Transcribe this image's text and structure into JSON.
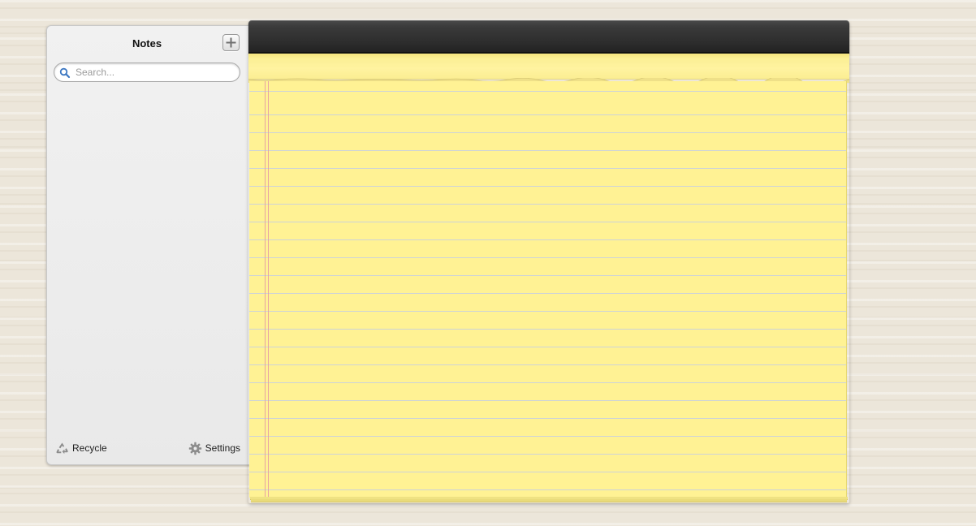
{
  "sidebar": {
    "title": "Notes",
    "add_button_label": "+",
    "search": {
      "placeholder": "Search...",
      "value": ""
    },
    "notes": [],
    "footer": {
      "recycle_label": "Recycle",
      "settings_label": "Settings"
    }
  },
  "notepad": {
    "content": ""
  },
  "colors": {
    "paper": "#fff294",
    "rule_line": "#cdd3d8",
    "margin_line": "#e8a4a1",
    "binding": "#2c2c2c",
    "sidebar_bg": "#ededed",
    "desk": "#ece6da"
  },
  "icons": {
    "add": "plus-icon",
    "search": "magnifier-icon",
    "recycle": "recycle-icon",
    "settings": "gear-icon"
  }
}
